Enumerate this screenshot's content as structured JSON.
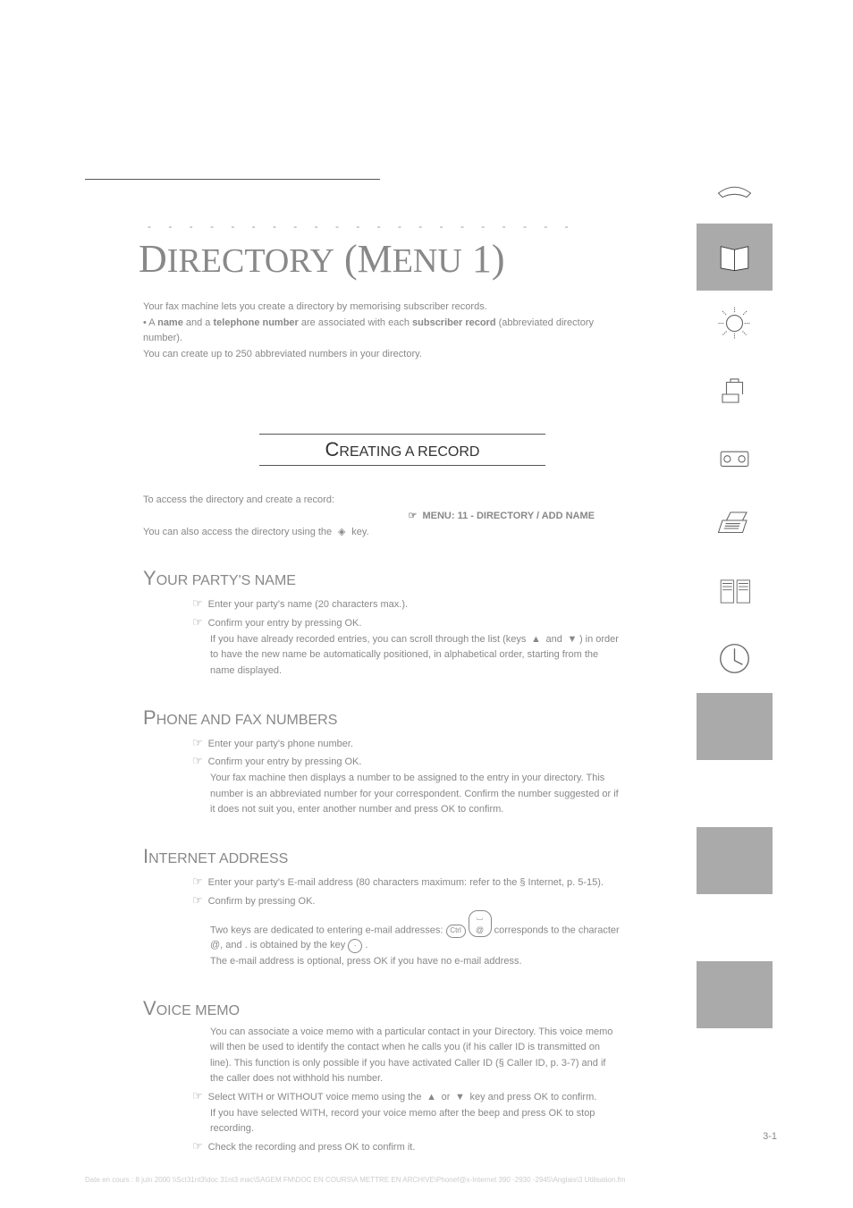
{
  "header": {
    "dashes": "- - - - - - - - - - - - - - - - - - - - -",
    "title_parts": [
      "D",
      "IRECTORY",
      " (M",
      "ENU",
      " 1)"
    ]
  },
  "intro": {
    "line1": "Your fax machine lets you create a directory by memorising subscriber records.",
    "line2a": "• A ",
    "line2b": "name",
    "line2c": " and a ",
    "line2d": "telephone number",
    "line2e": " are associated with each ",
    "line2f": "subscriber record",
    "line2g": " (abbreviated directory number).",
    "line3": "You can create up to 250 abbreviated numbers in your directory."
  },
  "creating_record": {
    "heading_parts": [
      "C",
      "REATING",
      " A RECORD"
    ],
    "access_text": "To access the directory and create a record:",
    "menu_path": "MENU: 11 - DIRECTORY / ADD NAME",
    "keys_text": "You can also access the directory using the    key.",
    "party_name": {
      "heading_parts": [
        "Y",
        "OUR",
        " PARTY",
        "'S",
        " NAME"
      ],
      "line1": "Enter your party's name (20 characters max.).",
      "line2": "Confirm your entry by pressing OK.",
      "note": "If you have already recorded entries, you can scroll through the list (keys   and   ) in order to have the new name be automatically positioned, in alphabetical order, starting from the name displayed."
    },
    "phone_fax": {
      "heading_parts": [
        "P",
        "HONE",
        " AND",
        " FAX",
        " NUMBERS"
      ],
      "line1": "Enter your party's phone number.",
      "line2": "Confirm your entry by pressing OK.",
      "para": "Your fax machine then displays a number to be assigned to the entry in your directory. This number is an abbreviated number for your correspondent. Confirm the number suggested or if it does not suit you, enter another number and press OK to confirm."
    },
    "internet": {
      "heading_parts": [
        "I",
        "NTERNET",
        " ADDRESS"
      ],
      "line1": "Enter your party's E-mail address (80 characters maximum: refer to the § Internet, p. 5-15).",
      "line2": "Confirm by pressing OK.",
      "para1": "Two keys are dedicated to entering e-mail addresses:       corresponds to the character",
      "para2": "@, and . is obtained by the key     .",
      "para3": "The e-mail address is optional, press OK if you have no e-mail address."
    },
    "voice_memo": {
      "heading_parts": [
        "V",
        "OICE",
        " MEMO"
      ],
      "para1": "You can associate a voice memo with a particular contact in your Directory. This voice memo will then be used to identify the contact when he calls you (if his caller ID is transmitted on line). This function is only possible if you have activated Caller ID (§ Caller ID, p. 3-7) and if the caller does not withhold his number.",
      "line1": "Select WITH or WITHOUT voice memo using the   or   key and press OK to confirm.",
      "para2": "If you have selected WITH, record your voice memo after the beep and press OK to stop recording.",
      "line2": "Check the recording and press OK to confirm it."
    }
  },
  "sidebar": {
    "icons": [
      "phone-icon",
      "directory-icon",
      "settings-icon",
      "fax-icon",
      "tad-icon",
      "print-icon",
      "options-icon",
      "safety-icon"
    ]
  },
  "page_number": "3-1",
  "footer": "Date en cours : 8 juin 2000   \\\\Sct31nt3\\doc 31nt3 mac\\SAGEM FM\\DOC EN COURS\\A METTRE EN ARCHIVE\\Phonef@x-Internet 390 -2930 -2945\\Anglais\\3 Utilisation.fm"
}
